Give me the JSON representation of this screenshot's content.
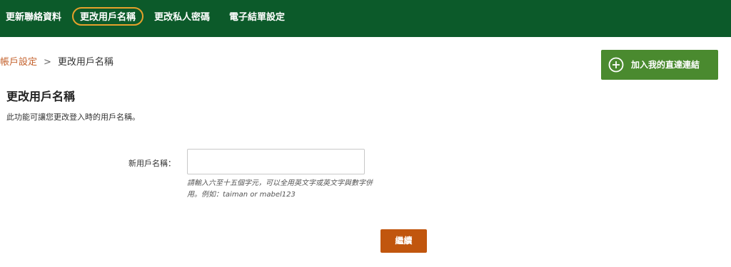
{
  "nav": {
    "items": [
      {
        "label": "更新聯絡資料"
      },
      {
        "label": "更改用戶名稱"
      },
      {
        "label": "更改私人密碼"
      },
      {
        "label": "電子結單設定"
      }
    ],
    "active_index": 1,
    "background_color": "#0c5a2a",
    "active_outline_color": "#e6a12b"
  },
  "breadcrumb": {
    "parent": "帳戶設定",
    "separator": ">",
    "current": "更改用戶名稱"
  },
  "shortcut_button": {
    "icon": "plus-circle-icon",
    "label": "加入我的直達連結",
    "color": "#4a8a2f"
  },
  "page": {
    "title": "更改用戶名稱",
    "description": "此功能可讓您更改登入時的用戶名稱。"
  },
  "form": {
    "label": "新用戶名稱：",
    "value": "",
    "hint": "請輸入六至十五個字元，可以全用英文字或英文字與數字併用。例如：taiman or mabel123"
  },
  "continue_button": {
    "label": "繼續",
    "color": "#c1560e"
  }
}
